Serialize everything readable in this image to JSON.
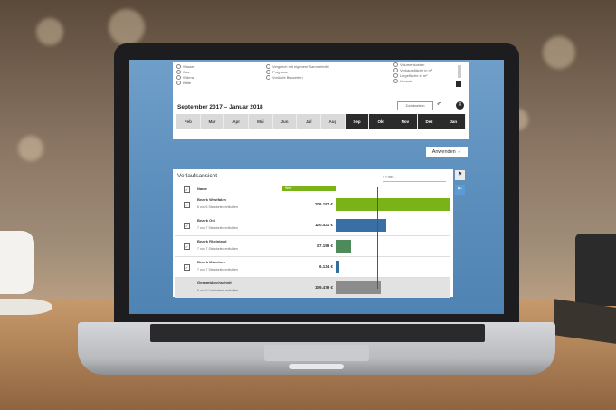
{
  "options": {
    "col1": [
      "Wasser",
      "Gas",
      "Wärme",
      "Kälte"
    ],
    "col2": [
      "Vergleich mit eigenem Sammelmittl",
      "Prognose",
      "Vorläufe Bauzeiten"
    ],
    "col3": [
      "Volumenkosten",
      "Verkaufsfläche in m²",
      "Liegefläche in m²",
      "Umsatz"
    ]
  },
  "range": {
    "title": "September 2017 – Januar 2018",
    "reset_label": "Zurücksetzen",
    "months": [
      {
        "label": "Feb",
        "selected": false
      },
      {
        "label": "Mär",
        "selected": false
      },
      {
        "label": "Apr",
        "selected": false
      },
      {
        "label": "Mai",
        "selected": false
      },
      {
        "label": "Jun",
        "selected": false
      },
      {
        "label": "Jul",
        "selected": false
      },
      {
        "label": "Aug",
        "selected": false
      },
      {
        "label": "Sep",
        "selected": true
      },
      {
        "label": "Okt",
        "selected": true
      },
      {
        "label": "Nov",
        "selected": true
      },
      {
        "label": "Dez",
        "selected": true
      },
      {
        "label": "Jan",
        "selected": true
      }
    ]
  },
  "apply_label": "Anwenden",
  "overview": {
    "title": "Verlaufsansicht",
    "filter_placeholder": "Filter...",
    "col_name": "Name",
    "col_value": "Wert",
    "rows": [
      {
        "name": "Bezirk Westfalen",
        "sub": "6 von 6 Standorten enthalten",
        "value": "276.157 €",
        "share": 1.0,
        "color": "#7ab317"
      },
      {
        "name": "Bezirk Ost",
        "sub": "7 von 7 Standorten enthalten",
        "value": "120.431 €",
        "share": 0.44,
        "color": "#3a6fa6"
      },
      {
        "name": "Bezirk Rheinland",
        "sub": "7 von 7 Standorten enthalten",
        "value": "37.199 €",
        "share": 0.13,
        "color": "#4e8a5a"
      },
      {
        "name": "Bezirk München",
        "sub": "7 von 7 Standorten enthalten",
        "value": "6.134 €",
        "share": 0.02,
        "color": "#2f6f9e"
      }
    ],
    "total": {
      "name": "Gesamtdurchschnitt",
      "sub": "6 von 6 Liebhabern enthalten",
      "value": "109.479 €",
      "share": 0.39,
      "color": "#8c8c8c"
    }
  }
}
